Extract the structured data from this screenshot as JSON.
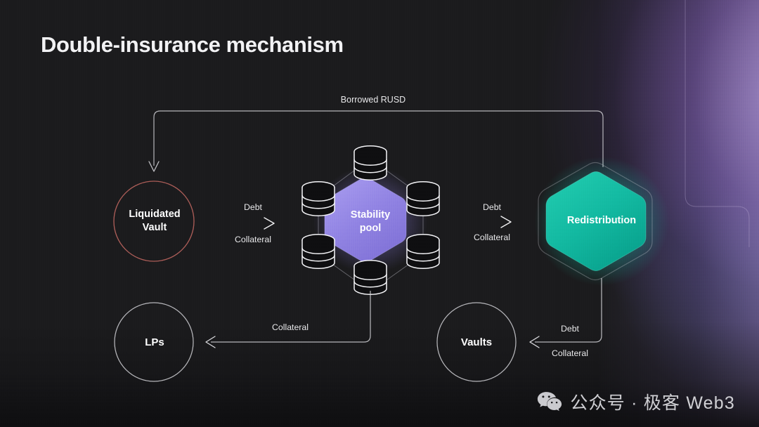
{
  "page": {
    "title": "Double-insurance mechanism",
    "background_color": "#1a1a1c",
    "accent_purple": "#8a7ce0",
    "accent_teal": "#11b9a1",
    "accent_red": "#a85a55"
  },
  "nodes": {
    "liquidated_vault": {
      "label": "Liquidated\nVault",
      "shape": "circle",
      "outline_color": "#a85a55"
    },
    "stability_pool": {
      "label": "Stability\npool",
      "shape": "hexagon",
      "fill_color": "#8a7ce0"
    },
    "redistribution": {
      "label": "Redistribution",
      "shape": "hexagon",
      "fill_color": "#11b9a1"
    },
    "lps": {
      "label": "LPs",
      "shape": "circle",
      "outline_color": "#cfcfd3"
    },
    "vaults": {
      "label": "Vaults",
      "shape": "circle",
      "outline_color": "#cfcfd3"
    }
  },
  "cluster": {
    "icon_name": "database-icon",
    "count": 6,
    "description": "Six database nodes arranged in a hexagon ring around the stability pool"
  },
  "edges": {
    "borrowed_rusd": {
      "label": "Borrowed RUSD",
      "from": "redistribution",
      "to": "liquidated_vault"
    },
    "vault_to_pool_debt": {
      "label": "Debt",
      "from": "liquidated_vault",
      "to": "stability_pool"
    },
    "vault_to_pool_coll": {
      "label": "Collateral",
      "from": "liquidated_vault",
      "to": "stability_pool"
    },
    "pool_to_redis_debt": {
      "label": "Debt",
      "from": "stability_pool",
      "to": "redistribution"
    },
    "pool_to_redis_coll": {
      "label": "Collateral",
      "from": "stability_pool",
      "to": "redistribution"
    },
    "pool_to_lps_coll": {
      "label": "Collateral",
      "from": "stability_pool",
      "to": "lps"
    },
    "redis_to_vaults_debt": {
      "label": "Debt",
      "from": "redistribution",
      "to": "vaults"
    },
    "redis_to_vaults_coll": {
      "label": "Collateral",
      "from": "redistribution",
      "to": "vaults"
    }
  },
  "watermark": {
    "icon_name": "wechat-icon",
    "text": "公众号 · 极客 Web3"
  }
}
